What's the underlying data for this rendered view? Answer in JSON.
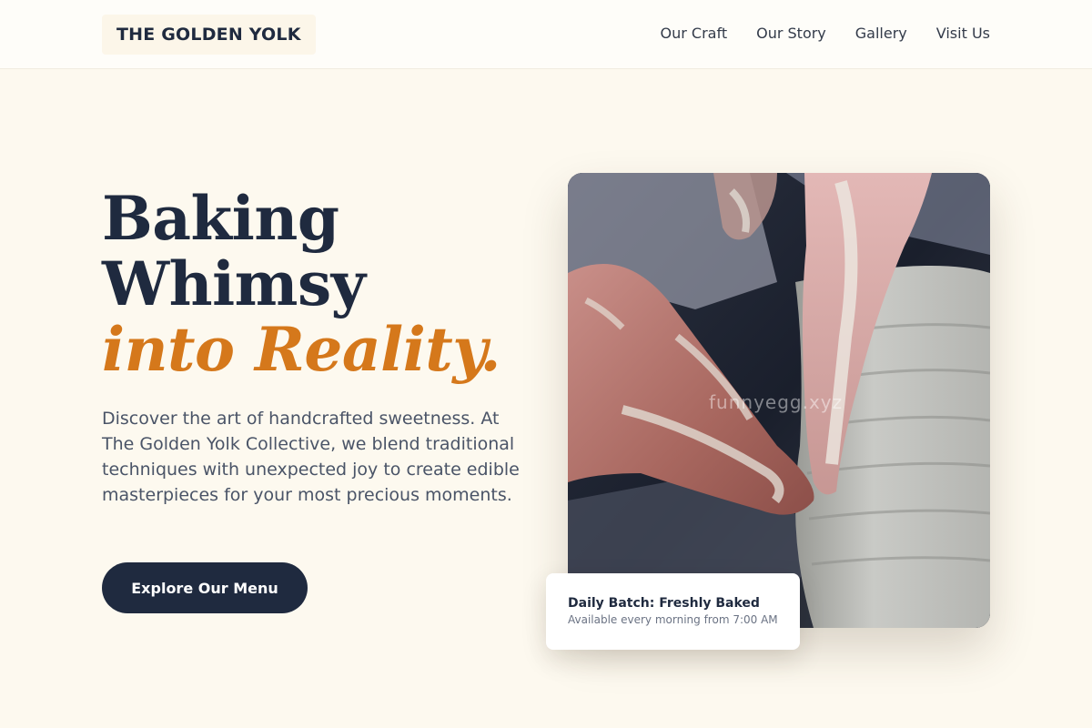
{
  "header": {
    "logo": "THE GOLDEN YOLK",
    "nav": [
      "Our Craft",
      "Our Story",
      "Gallery",
      "Visit Us"
    ]
  },
  "hero": {
    "title_line1": "Baking",
    "title_line2": "Whimsy",
    "title_accent": "into Reality.",
    "description": "Discover the art of handcrafted sweetness. At The Golden Yolk Collective, we blend traditional techniques with unexpected joy to create edible masterpieces for your most precious moments.",
    "cta_label": "Explore Our Menu"
  },
  "image": {
    "watermark": "funnyegg.xyz",
    "subject": "hands-shaping-clay-on-pottery-wheel"
  },
  "badge": {
    "title": "Daily Batch: Freshly Baked",
    "subtitle": "Available every morning from 7:00 AM"
  },
  "colors": {
    "background": "#fdf9ef",
    "primary": "#1f2a3f",
    "accent": "#d5781b"
  }
}
